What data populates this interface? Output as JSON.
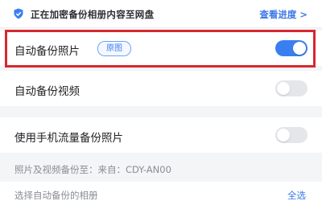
{
  "banner": {
    "text": "正在加密备份相册内容至网盘",
    "link": "查看进度 >",
    "icon": "shield-check-icon"
  },
  "settings": {
    "auto_backup_photos": {
      "label": "自动备份照片",
      "badge": "原图",
      "enabled": true
    },
    "auto_backup_videos": {
      "label": "自动备份视频",
      "enabled": false
    },
    "mobile_data_backup": {
      "label": "使用手机流量备份照片",
      "enabled": false
    }
  },
  "info": {
    "text": "照片及视频备份至：来自：CDY-AN00"
  },
  "album_select": {
    "label": "选择自动备份的相册",
    "select_all": "全选"
  },
  "colors": {
    "accent": "#3a7ff2",
    "highlight": "#d6282f",
    "toggle_off": "#e4e6ea"
  }
}
